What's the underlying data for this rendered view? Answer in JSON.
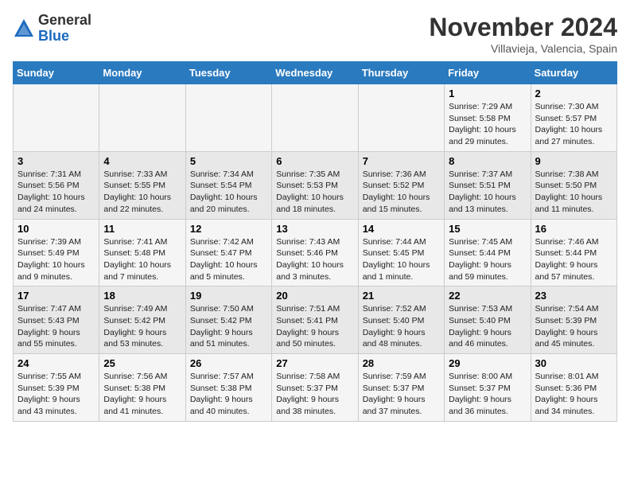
{
  "logo": {
    "general": "General",
    "blue": "Blue"
  },
  "title": "November 2024",
  "subtitle": "Villavieja, Valencia, Spain",
  "days_of_week": [
    "Sunday",
    "Monday",
    "Tuesday",
    "Wednesday",
    "Thursday",
    "Friday",
    "Saturday"
  ],
  "weeks": [
    [
      {
        "day": "",
        "info": ""
      },
      {
        "day": "",
        "info": ""
      },
      {
        "day": "",
        "info": ""
      },
      {
        "day": "",
        "info": ""
      },
      {
        "day": "",
        "info": ""
      },
      {
        "day": "1",
        "info": "Sunrise: 7:29 AM\nSunset: 5:58 PM\nDaylight: 10 hours\nand 29 minutes."
      },
      {
        "day": "2",
        "info": "Sunrise: 7:30 AM\nSunset: 5:57 PM\nDaylight: 10 hours\nand 27 minutes."
      }
    ],
    [
      {
        "day": "3",
        "info": "Sunrise: 7:31 AM\nSunset: 5:56 PM\nDaylight: 10 hours\nand 24 minutes."
      },
      {
        "day": "4",
        "info": "Sunrise: 7:33 AM\nSunset: 5:55 PM\nDaylight: 10 hours\nand 22 minutes."
      },
      {
        "day": "5",
        "info": "Sunrise: 7:34 AM\nSunset: 5:54 PM\nDaylight: 10 hours\nand 20 minutes."
      },
      {
        "day": "6",
        "info": "Sunrise: 7:35 AM\nSunset: 5:53 PM\nDaylight: 10 hours\nand 18 minutes."
      },
      {
        "day": "7",
        "info": "Sunrise: 7:36 AM\nSunset: 5:52 PM\nDaylight: 10 hours\nand 15 minutes."
      },
      {
        "day": "8",
        "info": "Sunrise: 7:37 AM\nSunset: 5:51 PM\nDaylight: 10 hours\nand 13 minutes."
      },
      {
        "day": "9",
        "info": "Sunrise: 7:38 AM\nSunset: 5:50 PM\nDaylight: 10 hours\nand 11 minutes."
      }
    ],
    [
      {
        "day": "10",
        "info": "Sunrise: 7:39 AM\nSunset: 5:49 PM\nDaylight: 10 hours\nand 9 minutes."
      },
      {
        "day": "11",
        "info": "Sunrise: 7:41 AM\nSunset: 5:48 PM\nDaylight: 10 hours\nand 7 minutes."
      },
      {
        "day": "12",
        "info": "Sunrise: 7:42 AM\nSunset: 5:47 PM\nDaylight: 10 hours\nand 5 minutes."
      },
      {
        "day": "13",
        "info": "Sunrise: 7:43 AM\nSunset: 5:46 PM\nDaylight: 10 hours\nand 3 minutes."
      },
      {
        "day": "14",
        "info": "Sunrise: 7:44 AM\nSunset: 5:45 PM\nDaylight: 10 hours\nand 1 minute."
      },
      {
        "day": "15",
        "info": "Sunrise: 7:45 AM\nSunset: 5:44 PM\nDaylight: 9 hours\nand 59 minutes."
      },
      {
        "day": "16",
        "info": "Sunrise: 7:46 AM\nSunset: 5:44 PM\nDaylight: 9 hours\nand 57 minutes."
      }
    ],
    [
      {
        "day": "17",
        "info": "Sunrise: 7:47 AM\nSunset: 5:43 PM\nDaylight: 9 hours\nand 55 minutes."
      },
      {
        "day": "18",
        "info": "Sunrise: 7:49 AM\nSunset: 5:42 PM\nDaylight: 9 hours\nand 53 minutes."
      },
      {
        "day": "19",
        "info": "Sunrise: 7:50 AM\nSunset: 5:42 PM\nDaylight: 9 hours\nand 51 minutes."
      },
      {
        "day": "20",
        "info": "Sunrise: 7:51 AM\nSunset: 5:41 PM\nDaylight: 9 hours\nand 50 minutes."
      },
      {
        "day": "21",
        "info": "Sunrise: 7:52 AM\nSunset: 5:40 PM\nDaylight: 9 hours\nand 48 minutes."
      },
      {
        "day": "22",
        "info": "Sunrise: 7:53 AM\nSunset: 5:40 PM\nDaylight: 9 hours\nand 46 minutes."
      },
      {
        "day": "23",
        "info": "Sunrise: 7:54 AM\nSunset: 5:39 PM\nDaylight: 9 hours\nand 45 minutes."
      }
    ],
    [
      {
        "day": "24",
        "info": "Sunrise: 7:55 AM\nSunset: 5:39 PM\nDaylight: 9 hours\nand 43 minutes."
      },
      {
        "day": "25",
        "info": "Sunrise: 7:56 AM\nSunset: 5:38 PM\nDaylight: 9 hours\nand 41 minutes."
      },
      {
        "day": "26",
        "info": "Sunrise: 7:57 AM\nSunset: 5:38 PM\nDaylight: 9 hours\nand 40 minutes."
      },
      {
        "day": "27",
        "info": "Sunrise: 7:58 AM\nSunset: 5:37 PM\nDaylight: 9 hours\nand 38 minutes."
      },
      {
        "day": "28",
        "info": "Sunrise: 7:59 AM\nSunset: 5:37 PM\nDaylight: 9 hours\nand 37 minutes."
      },
      {
        "day": "29",
        "info": "Sunrise: 8:00 AM\nSunset: 5:37 PM\nDaylight: 9 hours\nand 36 minutes."
      },
      {
        "day": "30",
        "info": "Sunrise: 8:01 AM\nSunset: 5:36 PM\nDaylight: 9 hours\nand 34 minutes."
      }
    ]
  ]
}
